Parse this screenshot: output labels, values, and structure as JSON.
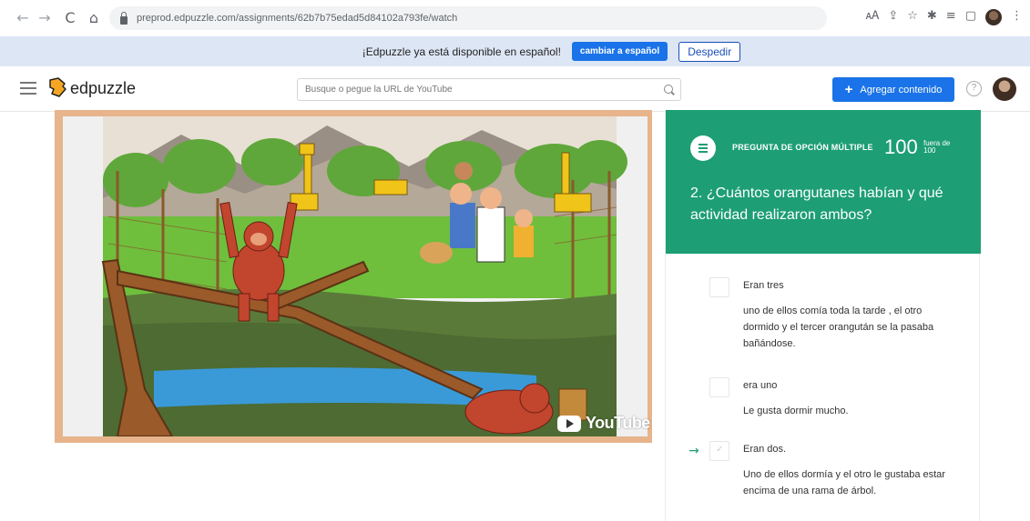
{
  "browser": {
    "url": "preprod.edpuzzle.com/assignments/62b7b75edad5d84102a793fe/watch",
    "back_icon": "←",
    "forward_icon": "→",
    "reload_icon": "C",
    "home_icon": "⌂"
  },
  "banner": {
    "message": "¡Edpuzzle ya está disponible en español!",
    "switch_label": "cambiar a español",
    "dismiss_label": "Despedir"
  },
  "header": {
    "logo_text": "edpuzzle",
    "search_placeholder": "Busque o pegue la URL de YouTube",
    "add_content_label": "Agregar contenido",
    "add_icon": "+",
    "help_icon": "?"
  },
  "video": {
    "youtube_label": "YouTube"
  },
  "question": {
    "type_label": "PREGUNTA DE OPCIÓN MÚLTIPLE",
    "score": "100",
    "score_label": "fuera de 100",
    "text": "2. ¿Cuántos orangutanes habían y qué actividad realizaron ambos?",
    "options": [
      {
        "title": "Eran tres",
        "body": "uno de ellos comía toda la tarde , el otro dormido y el tercer orangután se la pasaba bañándose.",
        "correct": false
      },
      {
        "title": "era uno",
        "body": "Le gusta dormir mucho.",
        "correct": false
      },
      {
        "title": "Eran dos.",
        "body": "Uno de ellos dormía y el otro le gustaba estar encima de una rama de árbol.",
        "correct": true,
        "arrow": "→",
        "tick": "✓"
      }
    ]
  },
  "colors": {
    "accent_green": "#1d9e74",
    "primary_blue": "#1a73e8",
    "banner_bg": "#dde6f5"
  }
}
